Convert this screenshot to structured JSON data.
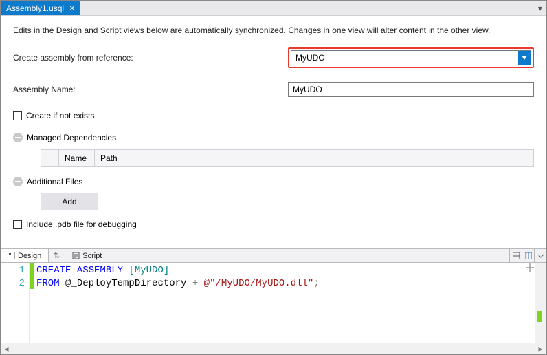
{
  "tab": {
    "title": "Assembly1.usql",
    "close_glyph": "×",
    "overflow_glyph": "▾"
  },
  "hint": "Edits in the Design and Script views below are automatically synchronized. Changes in one view will alter content in the other view.",
  "form": {
    "reference_label": "Create assembly from reference:",
    "reference_value": "MyUDO",
    "name_label": "Assembly Name:",
    "name_value": "MyUDO",
    "create_if_not_exists_label": "Create if not exists",
    "managed_deps_label": "Managed Dependencies",
    "dep_col_name": "Name",
    "dep_col_path": "Path",
    "additional_files_label": "Additional Files",
    "add_button": "Add",
    "include_pdb_label": "Include .pdb file for debugging"
  },
  "viewtabs": {
    "design": "Design",
    "script": "Script",
    "swap_glyph": "⇅"
  },
  "code": {
    "lines": [
      {
        "n": "1",
        "segments": [
          {
            "t": "CREATE",
            "c": "kw"
          },
          {
            "t": " ",
            "c": ""
          },
          {
            "t": "ASSEMBLY",
            "c": "kw"
          },
          {
            "t": " ",
            "c": ""
          },
          {
            "t": "[MyUDO]",
            "c": "ref"
          }
        ]
      },
      {
        "n": "2",
        "segments": [
          {
            "t": "FROM",
            "c": "kw"
          },
          {
            "t": " ",
            "c": ""
          },
          {
            "t": "@_DeployTempDirectory",
            "c": "var"
          },
          {
            "t": " ",
            "c": ""
          },
          {
            "t": "+",
            "c": "op"
          },
          {
            "t": " ",
            "c": ""
          },
          {
            "t": "@\"/MyUDO/MyUDO.dll\"",
            "c": "str"
          },
          {
            "t": ";",
            "c": "op"
          }
        ]
      }
    ]
  }
}
